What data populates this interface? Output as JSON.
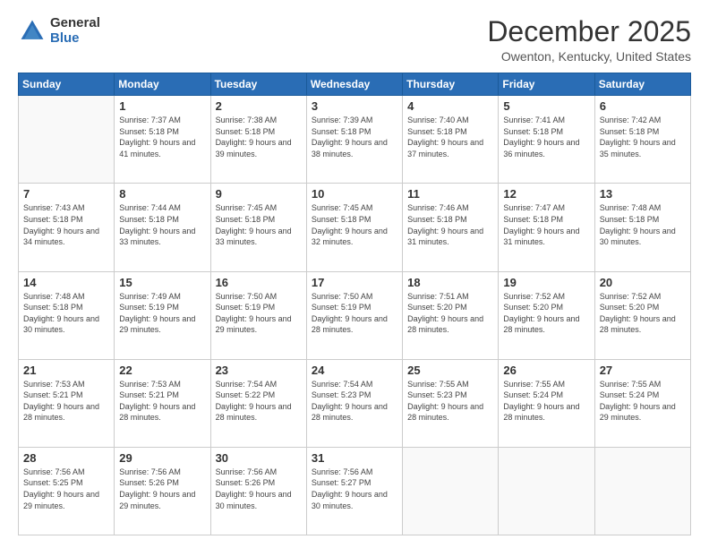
{
  "logo": {
    "general": "General",
    "blue": "Blue"
  },
  "header": {
    "title": "December 2025",
    "subtitle": "Owenton, Kentucky, United States"
  },
  "weekdays": [
    "Sunday",
    "Monday",
    "Tuesday",
    "Wednesday",
    "Thursday",
    "Friday",
    "Saturday"
  ],
  "weeks": [
    [
      {
        "day": "",
        "sunrise": "",
        "sunset": "",
        "daylight": ""
      },
      {
        "day": "1",
        "sunrise": "Sunrise: 7:37 AM",
        "sunset": "Sunset: 5:18 PM",
        "daylight": "Daylight: 9 hours and 41 minutes."
      },
      {
        "day": "2",
        "sunrise": "Sunrise: 7:38 AM",
        "sunset": "Sunset: 5:18 PM",
        "daylight": "Daylight: 9 hours and 39 minutes."
      },
      {
        "day": "3",
        "sunrise": "Sunrise: 7:39 AM",
        "sunset": "Sunset: 5:18 PM",
        "daylight": "Daylight: 9 hours and 38 minutes."
      },
      {
        "day": "4",
        "sunrise": "Sunrise: 7:40 AM",
        "sunset": "Sunset: 5:18 PM",
        "daylight": "Daylight: 9 hours and 37 minutes."
      },
      {
        "day": "5",
        "sunrise": "Sunrise: 7:41 AM",
        "sunset": "Sunset: 5:18 PM",
        "daylight": "Daylight: 9 hours and 36 minutes."
      },
      {
        "day": "6",
        "sunrise": "Sunrise: 7:42 AM",
        "sunset": "Sunset: 5:18 PM",
        "daylight": "Daylight: 9 hours and 35 minutes."
      }
    ],
    [
      {
        "day": "7",
        "sunrise": "Sunrise: 7:43 AM",
        "sunset": "Sunset: 5:18 PM",
        "daylight": "Daylight: 9 hours and 34 minutes."
      },
      {
        "day": "8",
        "sunrise": "Sunrise: 7:44 AM",
        "sunset": "Sunset: 5:18 PM",
        "daylight": "Daylight: 9 hours and 33 minutes."
      },
      {
        "day": "9",
        "sunrise": "Sunrise: 7:45 AM",
        "sunset": "Sunset: 5:18 PM",
        "daylight": "Daylight: 9 hours and 33 minutes."
      },
      {
        "day": "10",
        "sunrise": "Sunrise: 7:45 AM",
        "sunset": "Sunset: 5:18 PM",
        "daylight": "Daylight: 9 hours and 32 minutes."
      },
      {
        "day": "11",
        "sunrise": "Sunrise: 7:46 AM",
        "sunset": "Sunset: 5:18 PM",
        "daylight": "Daylight: 9 hours and 31 minutes."
      },
      {
        "day": "12",
        "sunrise": "Sunrise: 7:47 AM",
        "sunset": "Sunset: 5:18 PM",
        "daylight": "Daylight: 9 hours and 31 minutes."
      },
      {
        "day": "13",
        "sunrise": "Sunrise: 7:48 AM",
        "sunset": "Sunset: 5:18 PM",
        "daylight": "Daylight: 9 hours and 30 minutes."
      }
    ],
    [
      {
        "day": "14",
        "sunrise": "Sunrise: 7:48 AM",
        "sunset": "Sunset: 5:18 PM",
        "daylight": "Daylight: 9 hours and 30 minutes."
      },
      {
        "day": "15",
        "sunrise": "Sunrise: 7:49 AM",
        "sunset": "Sunset: 5:19 PM",
        "daylight": "Daylight: 9 hours and 29 minutes."
      },
      {
        "day": "16",
        "sunrise": "Sunrise: 7:50 AM",
        "sunset": "Sunset: 5:19 PM",
        "daylight": "Daylight: 9 hours and 29 minutes."
      },
      {
        "day": "17",
        "sunrise": "Sunrise: 7:50 AM",
        "sunset": "Sunset: 5:19 PM",
        "daylight": "Daylight: 9 hours and 28 minutes."
      },
      {
        "day": "18",
        "sunrise": "Sunrise: 7:51 AM",
        "sunset": "Sunset: 5:20 PM",
        "daylight": "Daylight: 9 hours and 28 minutes."
      },
      {
        "day": "19",
        "sunrise": "Sunrise: 7:52 AM",
        "sunset": "Sunset: 5:20 PM",
        "daylight": "Daylight: 9 hours and 28 minutes."
      },
      {
        "day": "20",
        "sunrise": "Sunrise: 7:52 AM",
        "sunset": "Sunset: 5:20 PM",
        "daylight": "Daylight: 9 hours and 28 minutes."
      }
    ],
    [
      {
        "day": "21",
        "sunrise": "Sunrise: 7:53 AM",
        "sunset": "Sunset: 5:21 PM",
        "daylight": "Daylight: 9 hours and 28 minutes."
      },
      {
        "day": "22",
        "sunrise": "Sunrise: 7:53 AM",
        "sunset": "Sunset: 5:21 PM",
        "daylight": "Daylight: 9 hours and 28 minutes."
      },
      {
        "day": "23",
        "sunrise": "Sunrise: 7:54 AM",
        "sunset": "Sunset: 5:22 PM",
        "daylight": "Daylight: 9 hours and 28 minutes."
      },
      {
        "day": "24",
        "sunrise": "Sunrise: 7:54 AM",
        "sunset": "Sunset: 5:23 PM",
        "daylight": "Daylight: 9 hours and 28 minutes."
      },
      {
        "day": "25",
        "sunrise": "Sunrise: 7:55 AM",
        "sunset": "Sunset: 5:23 PM",
        "daylight": "Daylight: 9 hours and 28 minutes."
      },
      {
        "day": "26",
        "sunrise": "Sunrise: 7:55 AM",
        "sunset": "Sunset: 5:24 PM",
        "daylight": "Daylight: 9 hours and 28 minutes."
      },
      {
        "day": "27",
        "sunrise": "Sunrise: 7:55 AM",
        "sunset": "Sunset: 5:24 PM",
        "daylight": "Daylight: 9 hours and 29 minutes."
      }
    ],
    [
      {
        "day": "28",
        "sunrise": "Sunrise: 7:56 AM",
        "sunset": "Sunset: 5:25 PM",
        "daylight": "Daylight: 9 hours and 29 minutes."
      },
      {
        "day": "29",
        "sunrise": "Sunrise: 7:56 AM",
        "sunset": "Sunset: 5:26 PM",
        "daylight": "Daylight: 9 hours and 29 minutes."
      },
      {
        "day": "30",
        "sunrise": "Sunrise: 7:56 AM",
        "sunset": "Sunset: 5:26 PM",
        "daylight": "Daylight: 9 hours and 30 minutes."
      },
      {
        "day": "31",
        "sunrise": "Sunrise: 7:56 AM",
        "sunset": "Sunset: 5:27 PM",
        "daylight": "Daylight: 9 hours and 30 minutes."
      },
      {
        "day": "",
        "sunrise": "",
        "sunset": "",
        "daylight": ""
      },
      {
        "day": "",
        "sunrise": "",
        "sunset": "",
        "daylight": ""
      },
      {
        "day": "",
        "sunrise": "",
        "sunset": "",
        "daylight": ""
      }
    ]
  ]
}
